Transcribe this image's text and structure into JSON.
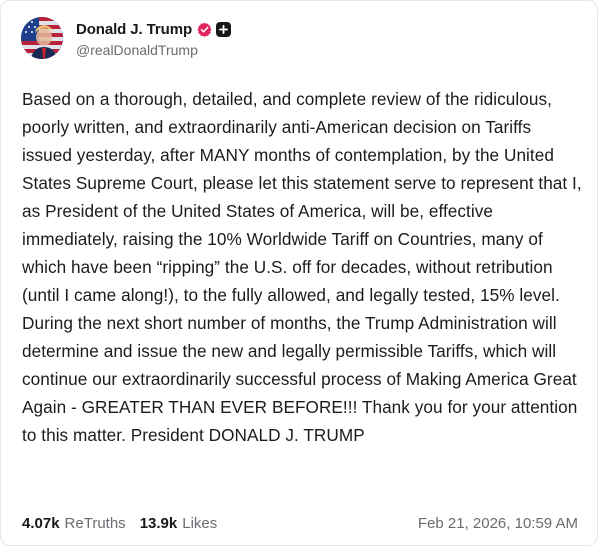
{
  "author": {
    "display_name": "Donald J. Trump",
    "handle": "@realDonaldTrump",
    "verified_color": "#e0245e"
  },
  "post": {
    "text": "Based on a thorough, detailed, and complete review of the ridiculous, poorly written, and extraordinarily anti-American decision on Tariffs issued yesterday, after MANY months of contemplation, by the United States Supreme Court, please let this statement serve to represent that I, as President of the United States of America, will be, effective immediately, raising the 10% Worldwide Tariff on Countries, many of which have been “ripping” the U.S. off for decades, without retribution (until I came along!), to the fully allowed, and legally tested, 15% level. During the next short number of months, the Trump Administration will determine and issue the new and legally permissible Tariffs, which will continue our extraordinarily successful process of Making America Great Again - GREATER THAN EVER BEFORE!!! Thank you for your attention to this matter. President DONALD J. TRUMP"
  },
  "stats": {
    "retruths_count": "4.07k",
    "retruths_label": "ReTruths",
    "likes_count": "13.9k",
    "likes_label": "Likes"
  },
  "timestamp": "Feb 21, 2026, 10:59 AM",
  "icons": {
    "avatar": "profile-photo",
    "verified": "verified-badge-icon",
    "badge": "plus-badge-icon"
  }
}
